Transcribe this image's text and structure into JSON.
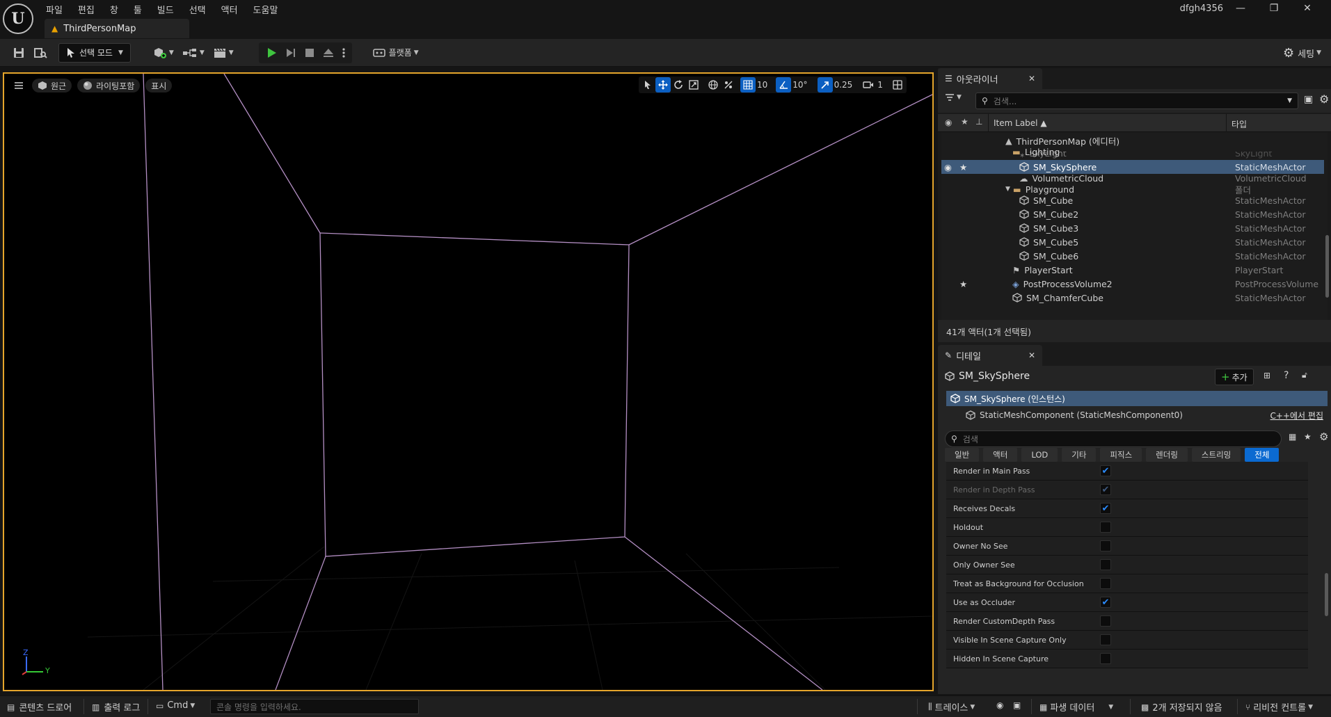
{
  "menu": [
    "파일",
    "편집",
    "창",
    "툴",
    "빌드",
    "선택",
    "액터",
    "도움말"
  ],
  "document_tab": "ThirdPersonMap",
  "user": "dfgh4356",
  "toolbar": {
    "mode_label": "선택 모드",
    "platform_label": "플랫폼",
    "settings_label": "세팅"
  },
  "viewport": {
    "perspective_label": "원근",
    "lighting_label": "라이팅포함",
    "show_label": "표시",
    "grid_snap": "10",
    "rotation_snap": "10°",
    "scale_snap": "0.25",
    "camera_speed": "1",
    "axis_z": "Z",
    "axis_y": "Y"
  },
  "outliner": {
    "tab_title": "아웃라이너",
    "search_placeholder": "검색...",
    "col_label": "Item Label",
    "col_type": "타입",
    "rows": [
      {
        "label": "ThirdPersonMap (에디터)",
        "type": ""
      },
      {
        "label": "Lighting",
        "type": ""
      },
      {
        "label": "SkyLight",
        "type": "SkyLight"
      },
      {
        "label": "SM_SkySphere",
        "type": "StaticMeshActor"
      },
      {
        "label": "VolumetricCloud",
        "type": "VolumetricCloud"
      },
      {
        "label": "Playground",
        "type": "폴더"
      },
      {
        "label": "SM_Cube",
        "type": "StaticMeshActor"
      },
      {
        "label": "SM_Cube2",
        "type": "StaticMeshActor"
      },
      {
        "label": "SM_Cube3",
        "type": "StaticMeshActor"
      },
      {
        "label": "SM_Cube5",
        "type": "StaticMeshActor"
      },
      {
        "label": "SM_Cube6",
        "type": "StaticMeshActor"
      },
      {
        "label": "PlayerStart",
        "type": "PlayerStart"
      },
      {
        "label": "PostProcessVolume2",
        "type": "PostProcessVolume"
      },
      {
        "label": "SM_ChamferCube",
        "type": "StaticMeshActor"
      }
    ],
    "status": "41개 액터(1개 선택됨)"
  },
  "details": {
    "tab_title": "디테일",
    "actor_name": "SM_SkySphere",
    "add_label": "추가",
    "instance_label": "SM_SkySphere (인스턴스)",
    "component_label": "StaticMeshComponent (StaticMeshComponent0)",
    "edit_cpp": "C++에서 편집",
    "search_placeholder": "검색",
    "categories": [
      "일반",
      "액터",
      "LOD",
      "기타",
      "피직스",
      "렌더링",
      "스트리밍",
      "전체"
    ],
    "properties": [
      {
        "label": "Render in Main Pass",
        "checked": true,
        "dim": false
      },
      {
        "label": "Render in Depth Pass",
        "checked": true,
        "dim": true
      },
      {
        "label": "Receives Decals",
        "checked": true,
        "dim": false
      },
      {
        "label": "Holdout",
        "checked": false,
        "dim": false
      },
      {
        "label": "Owner No See",
        "checked": false,
        "dim": false
      },
      {
        "label": "Only Owner See",
        "checked": false,
        "dim": false
      },
      {
        "label": "Treat as Background for Occlusion",
        "checked": false,
        "dim": false
      },
      {
        "label": "Use as Occluder",
        "checked": true,
        "dim": false
      },
      {
        "label": "Render CustomDepth Pass",
        "checked": false,
        "dim": false
      },
      {
        "label": "Visible In Scene Capture Only",
        "checked": false,
        "dim": false
      },
      {
        "label": "Hidden In Scene Capture",
        "checked": false,
        "dim": false
      }
    ]
  },
  "statusbar": {
    "content_drawer": "콘텐츠 드로어",
    "output_log": "출력 로그",
    "cmd": "Cmd",
    "console_placeholder": "콘솔 명령을 입력하세요.",
    "trace": "트레이스",
    "derived_data": "파생 데이터",
    "unsaved": "2개 저장되지 않음",
    "revision_control": "리비전 컨트롤"
  },
  "colors": {
    "accent": "#0b6ad1",
    "selection": "#3e5a7a",
    "viewport_border": "#e5a52b",
    "wire": "#c9a3d6",
    "play_green": "#3fc43f"
  }
}
